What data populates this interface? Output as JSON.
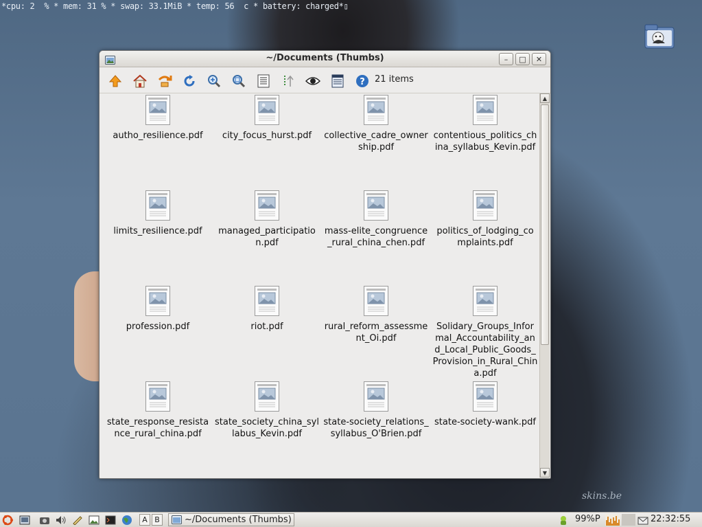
{
  "status_bar": {
    "text": "*cpu: 2  % * mem: 31 % * swap: 33.1MiB * temp: 56  c * battery: charged*▯"
  },
  "watermark": "skins.be",
  "window": {
    "title": "~/Documents (Thumbs)",
    "minimize_label": "–",
    "maximize_label": "□",
    "close_label": "✕"
  },
  "toolbar": {
    "buttons": [
      "up-arrow-icon",
      "home-icon",
      "go-to-icon",
      "refresh-icon",
      "zoom-in-icon",
      "zoom-fit-icon",
      "list-view-icon",
      "sort-icon",
      "eye-icon",
      "details-view-icon",
      "help-icon"
    ],
    "item_count": "21 items"
  },
  "files": [
    "autho_resilience.pdf",
    "city_focus_hurst.pdf",
    "collective_cadre_ownership.pdf",
    "contentious_politics_china_syllabus_Kevin.pdf",
    "limits_resilience.pdf",
    "managed_participation.pdf",
    "mass-elite_congruence_rural_china_chen.pdf",
    "politics_of_lodging_complaints.pdf",
    "profession.pdf",
    "riot.pdf",
    "rural_reform_assessment_Oi.pdf",
    "Solidary_Groups_Informal_Accountability_and_Local_Public_Goods_Provision_in_Rural_China.pdf",
    "state_response_resistance_rural_china.pdf",
    "state_society_china_syllabus_Kevin.pdf",
    "state-society_relations_syllabus_O'Brien.pdf",
    "state-society-wank.pdf"
  ],
  "scrollbar": {
    "up_label": "▲",
    "down_label": "▼"
  },
  "taskbar": {
    "workspace_a": "A",
    "workspace_b": "B",
    "task_label": "~/Documents (Thumbs)",
    "battery": "99%P",
    "clock": "22:32:55"
  },
  "colors": {
    "window_bg": "#edeceb",
    "desktop": "#5d7590",
    "accent_orange": "#f08a1c",
    "accent_blue": "#2f6fbf"
  }
}
